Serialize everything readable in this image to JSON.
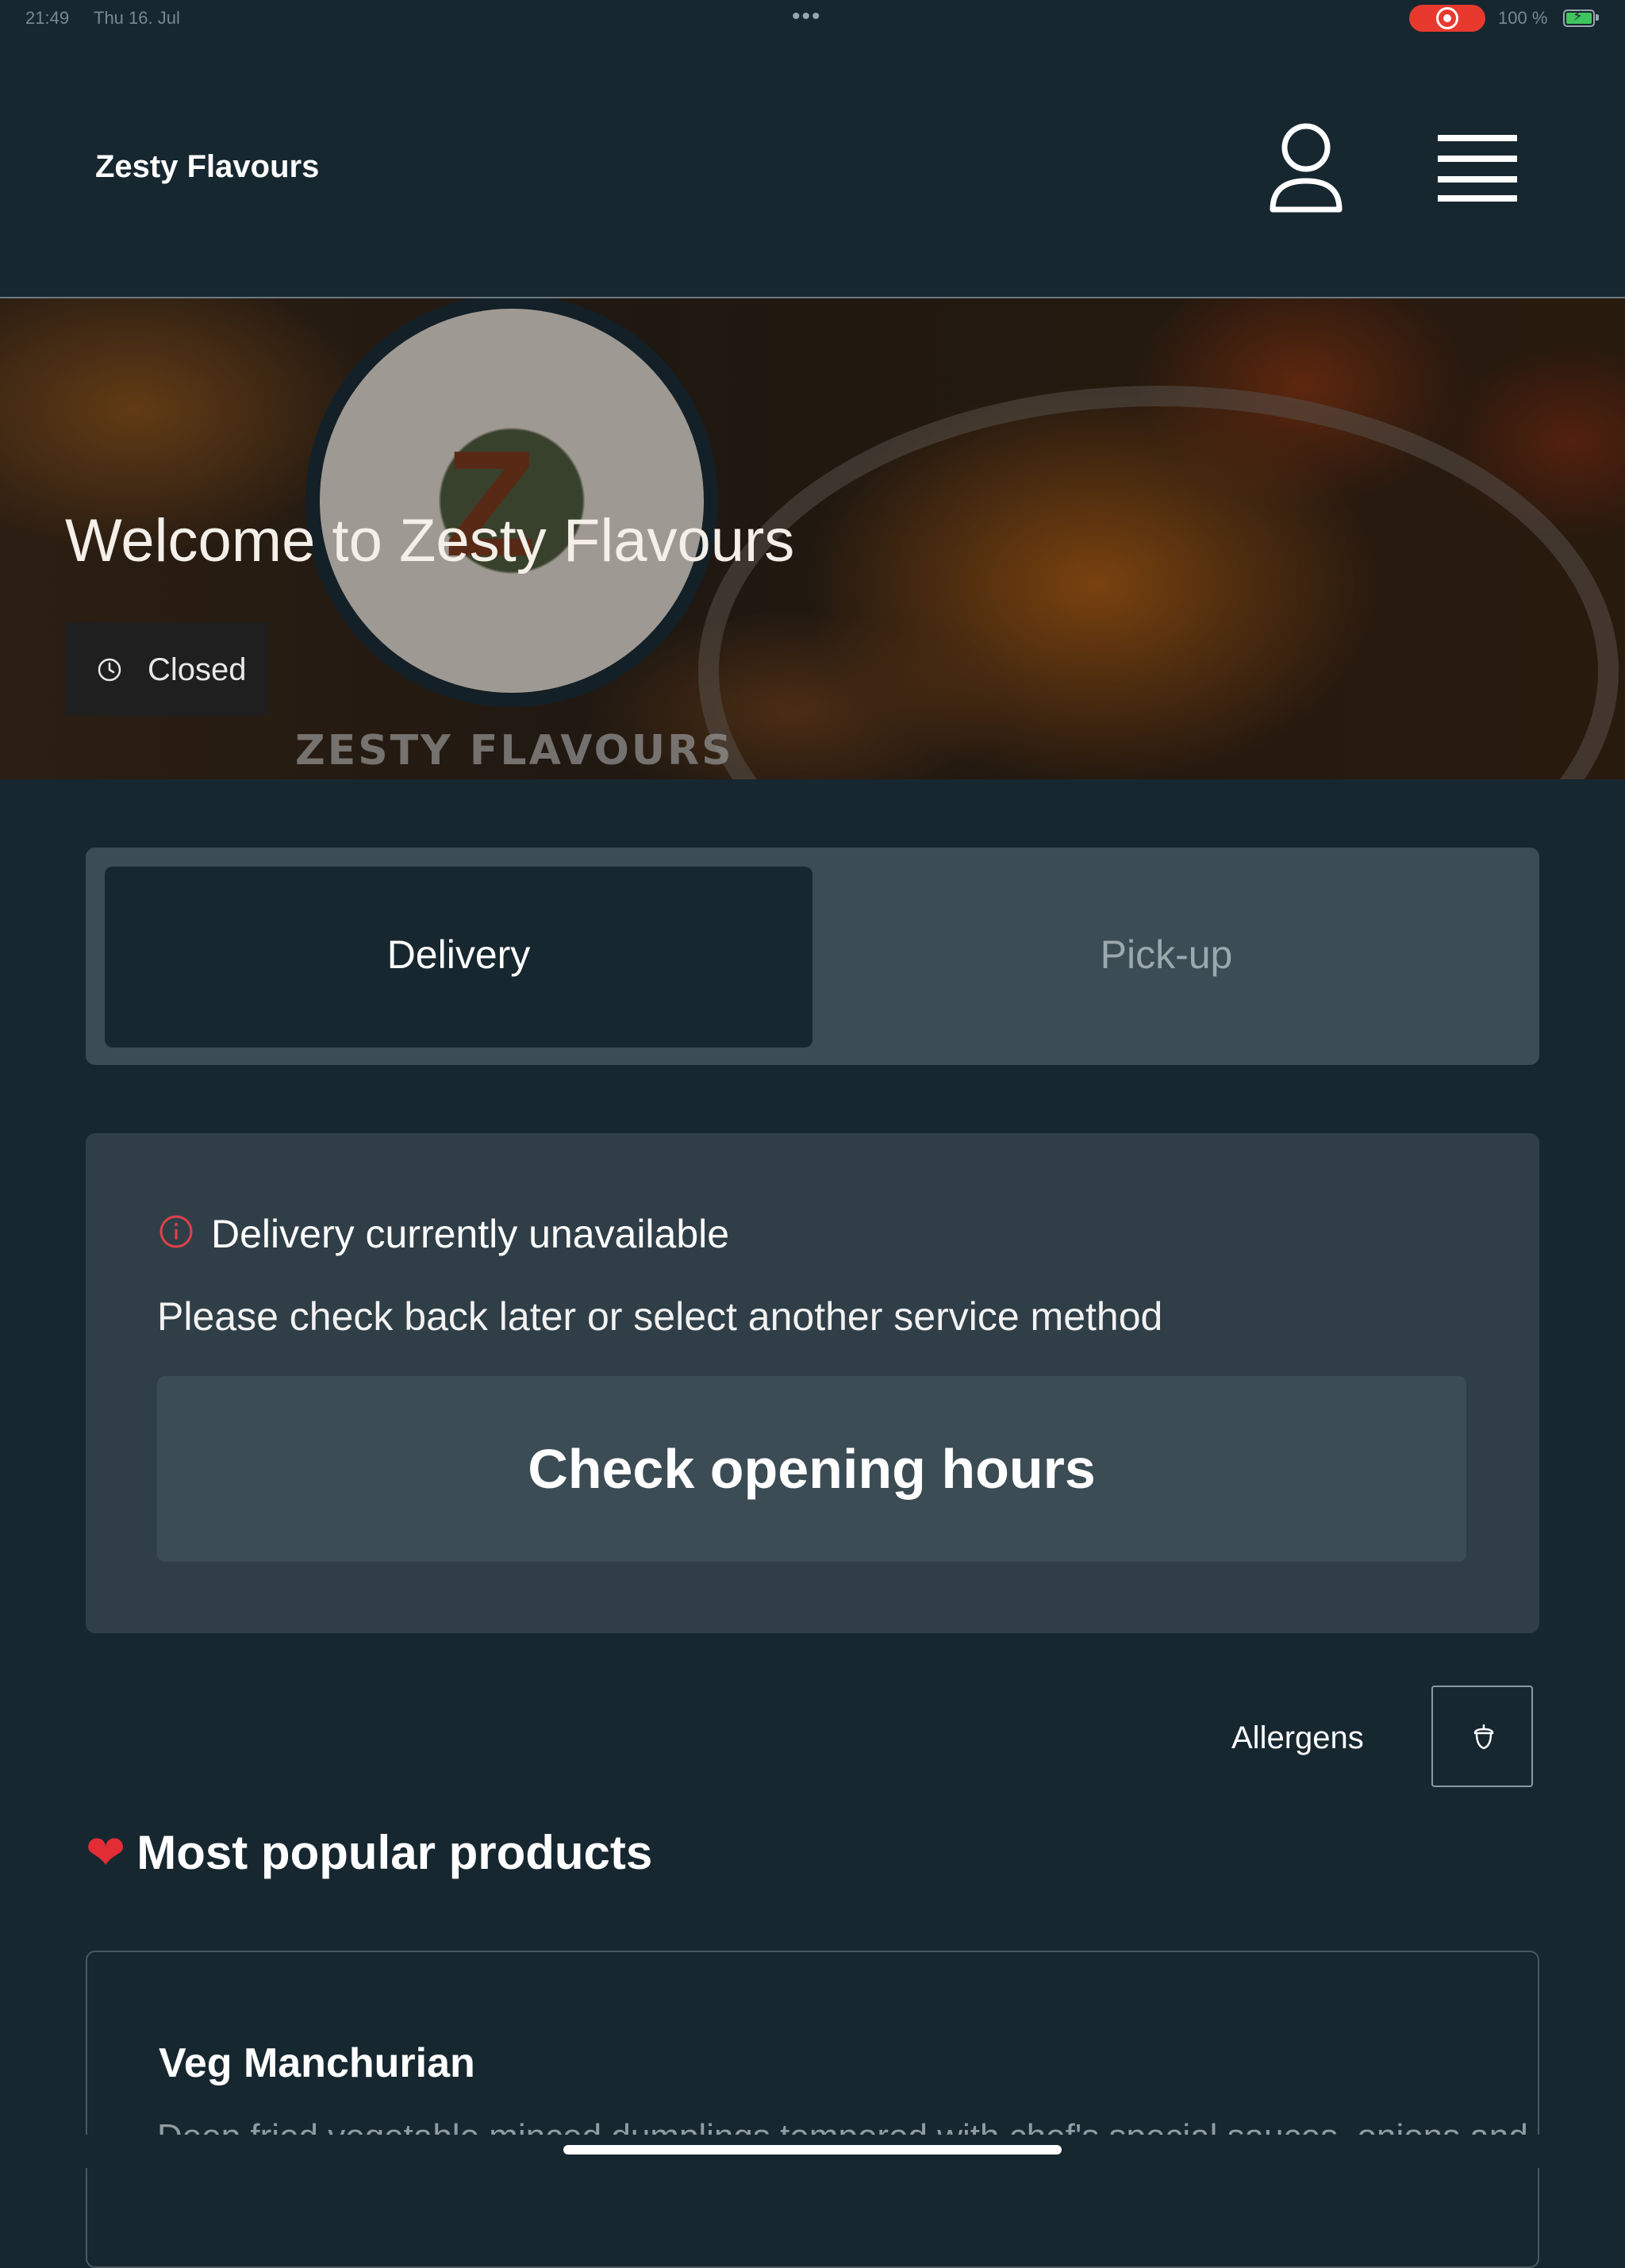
{
  "status_bar": {
    "time": "21:49",
    "date": "Thu 16. Jul",
    "battery": "100 %",
    "recording_color": "#e8392f"
  },
  "header": {
    "brand": "Zesty Flavours",
    "user_icon": "user-icon",
    "menu_icon": "hamburger-menu-icon"
  },
  "hero": {
    "title": "Welcome to Zesty Flavours",
    "status": "Closed",
    "status_icon": "clock-icon",
    "logo_text": "ZESTY FLAVOURS"
  },
  "service_toggle": {
    "options": [
      "Delivery",
      "Pick-up"
    ],
    "selected": "Delivery"
  },
  "notice": {
    "icon": "info-icon",
    "icon_color": "#e0414b",
    "title": "Delivery currently unavailable",
    "message": "Please check back later or select another service method",
    "button_label": "Check opening hours"
  },
  "allergens": {
    "label": "Allergens",
    "icon": "acorn-icon"
  },
  "popular": {
    "title": "Most popular products",
    "icon": "heart-icon",
    "products": [
      {
        "name": "Veg Manchurian",
        "description": "Deep fried vegetable minced dumplings tempered with chef's special sauces, onions and"
      }
    ]
  },
  "colors": {
    "background": "#172730",
    "panel": "#303f47",
    "toggle_track": "#3c4c55",
    "accent_red": "#e0414b"
  }
}
